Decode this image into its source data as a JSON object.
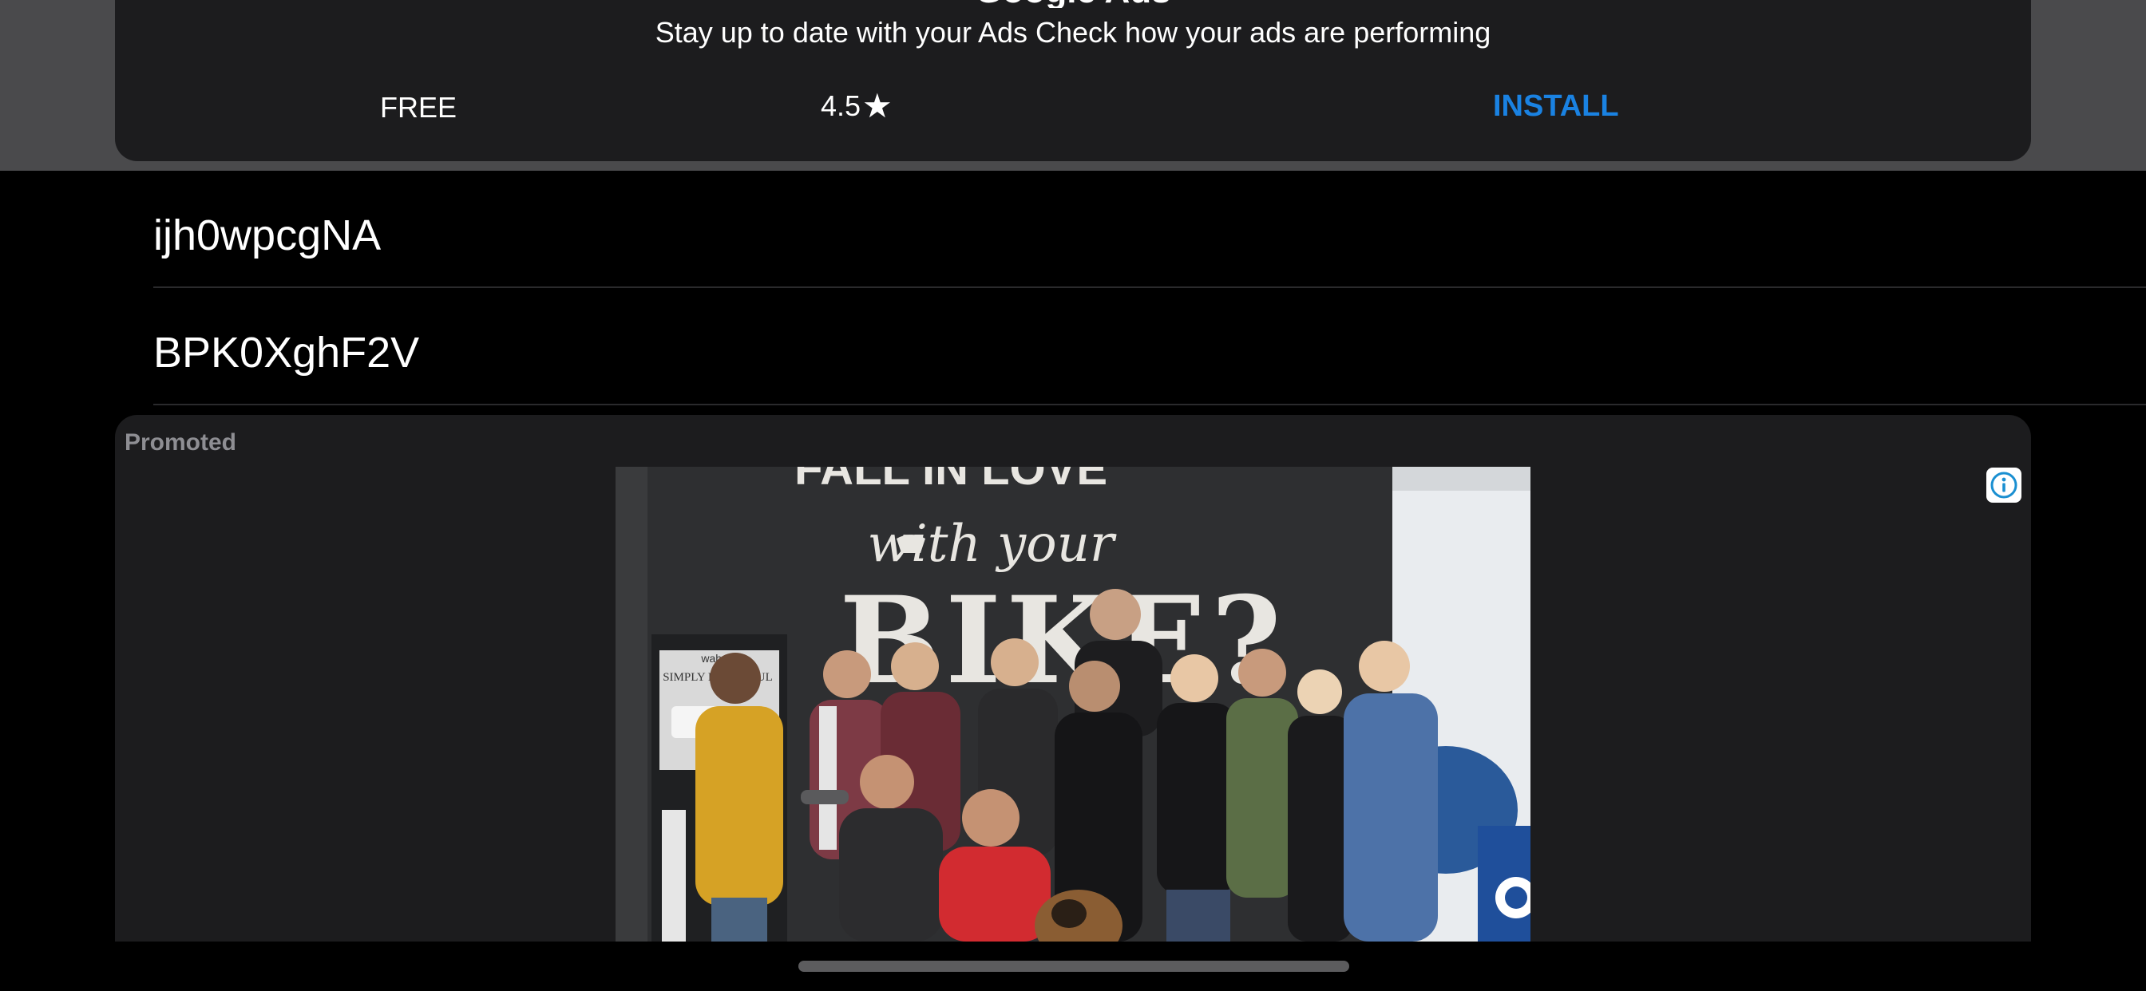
{
  "top_ad": {
    "title": "Google Ads",
    "subtitle": "Stay up to date with your Ads Check how your ads are performing",
    "price": "FREE",
    "rating": "4.5",
    "rating_star": "★",
    "install_label": "INSTALL",
    "install_color": "#1a82e2"
  },
  "list": {
    "items": [
      {
        "label": "ijh0wpcgNA"
      },
      {
        "label": "BPK0XghF2V"
      }
    ]
  },
  "promoted": {
    "label": "Promoted",
    "info_icon": "info-icon",
    "image_description_icon": "ad-photo",
    "wall_text_top": "FALL IN LOVE",
    "wall_text_mid": "with your",
    "wall_text_big": "BIKE?",
    "sign_text": "SIMPLY POWERFUL",
    "sign_brand": "wahoo"
  },
  "colors": {
    "background": "#000000",
    "card": "#1c1c1e",
    "top_band": "#4a4a4c",
    "muted_text": "#8e8e93",
    "info_icon": "#1a8fd1"
  }
}
